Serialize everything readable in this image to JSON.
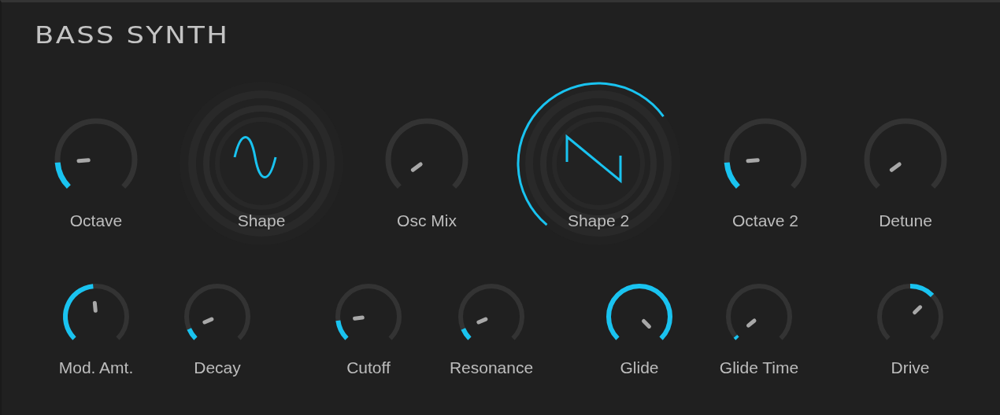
{
  "title": "BASS SYNTH",
  "top_row": [
    {
      "label": "Octave",
      "kind": "unipolar"
    },
    {
      "label": "Shape",
      "kind": "sine"
    },
    {
      "label": "Osc Mix",
      "kind": "plain"
    },
    {
      "label": "Shape 2",
      "kind": "saw"
    },
    {
      "label": "Octave 2",
      "kind": "unipolar"
    },
    {
      "label": "Detune",
      "kind": "plain"
    }
  ],
  "bottom_row": [
    {
      "label": "Mod. Amt.",
      "kind": "unipolar"
    },
    {
      "label": "Decay",
      "kind": "unipolar"
    },
    {
      "label": "Cutoff",
      "kind": "unipolar"
    },
    {
      "label": "Resonance",
      "kind": "unipolar"
    },
    {
      "label": "Glide",
      "kind": "unipolar"
    },
    {
      "label": "Glide Time",
      "kind": "unipolar"
    },
    {
      "label": "Drive",
      "kind": "bipolar"
    }
  ]
}
